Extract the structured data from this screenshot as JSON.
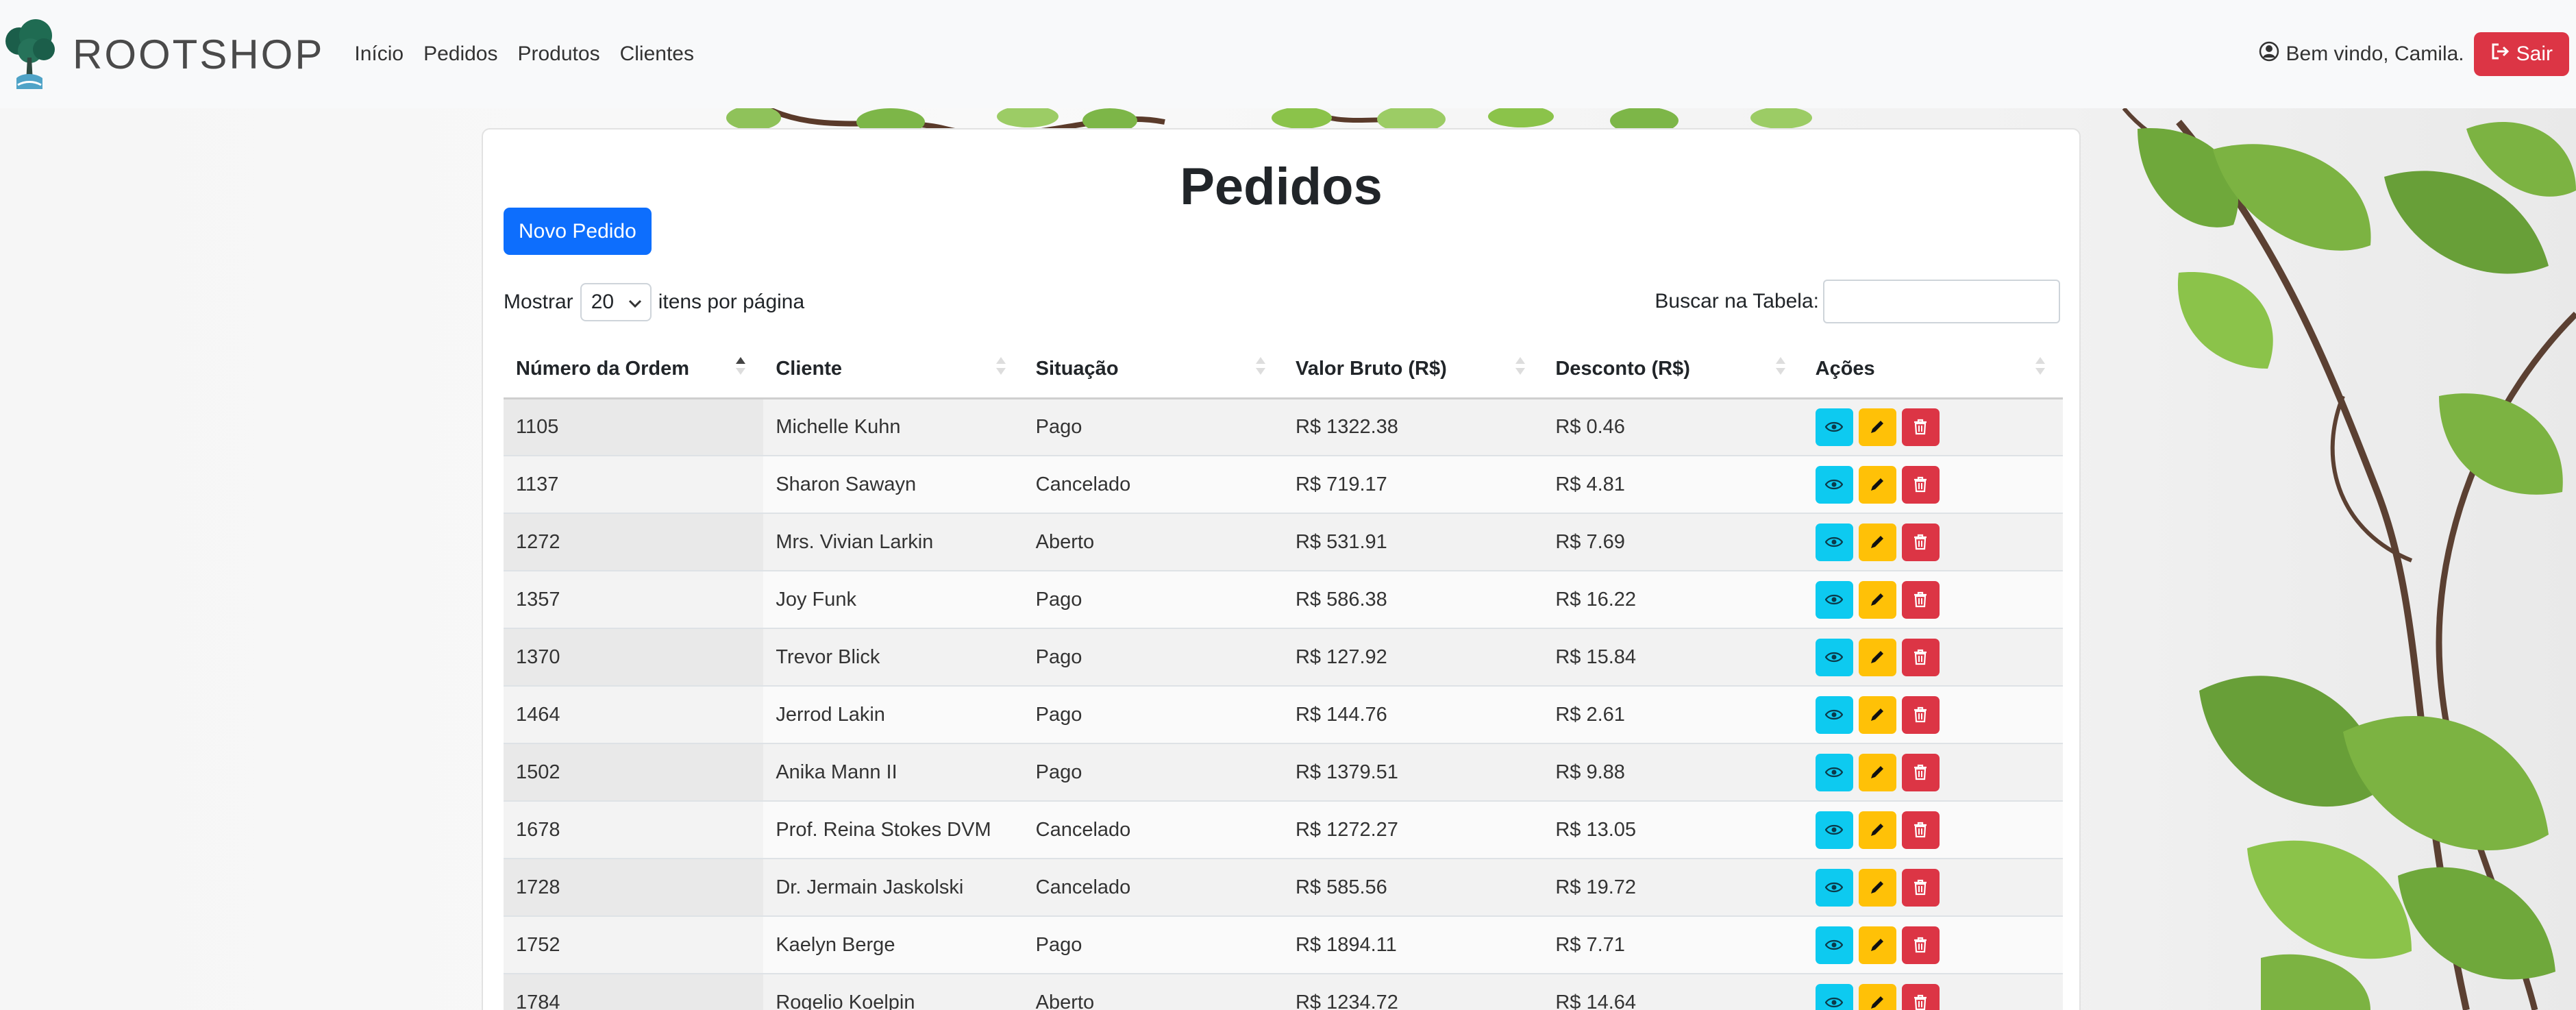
{
  "nav": {
    "brand": "ROOTSHOP",
    "links": [
      "Início",
      "Pedidos",
      "Produtos",
      "Clientes"
    ],
    "welcome": "Bem vindo, Camila.",
    "logout": "Sair"
  },
  "page": {
    "title": "Pedidos",
    "new_button": "Novo Pedido",
    "length_prefix": "Mostrar",
    "length_value": "20",
    "length_suffix": "itens por página",
    "search_label": "Buscar na Tabela:",
    "search_value": ""
  },
  "table": {
    "columns": [
      "Número da Ordem",
      "Cliente",
      "Situação",
      "Valor Bruto (R$)",
      "Desconto (R$)",
      "Ações"
    ],
    "sorted_column": "Número da Ordem",
    "rows": [
      {
        "id": "1105",
        "client": "Michelle Kuhn",
        "status": "Pago",
        "gross": "R$ 1322.38",
        "discount": "R$ 0.46"
      },
      {
        "id": "1137",
        "client": "Sharon Sawayn",
        "status": "Cancelado",
        "gross": "R$ 719.17",
        "discount": "R$ 4.81"
      },
      {
        "id": "1272",
        "client": "Mrs. Vivian Larkin",
        "status": "Aberto",
        "gross": "R$ 531.91",
        "discount": "R$ 7.69"
      },
      {
        "id": "1357",
        "client": "Joy Funk",
        "status": "Pago",
        "gross": "R$ 586.38",
        "discount": "R$ 16.22"
      },
      {
        "id": "1370",
        "client": "Trevor Blick",
        "status": "Pago",
        "gross": "R$ 127.92",
        "discount": "R$ 15.84"
      },
      {
        "id": "1464",
        "client": "Jerrod Lakin",
        "status": "Pago",
        "gross": "R$ 144.76",
        "discount": "R$ 2.61"
      },
      {
        "id": "1502",
        "client": "Anika Mann II",
        "status": "Pago",
        "gross": "R$ 1379.51",
        "discount": "R$ 9.88"
      },
      {
        "id": "1678",
        "client": "Prof. Reina Stokes DVM",
        "status": "Cancelado",
        "gross": "R$ 1272.27",
        "discount": "R$ 13.05"
      },
      {
        "id": "1728",
        "client": "Dr. Jermain Jaskolski",
        "status": "Cancelado",
        "gross": "R$ 585.56",
        "discount": "R$ 19.72"
      },
      {
        "id": "1752",
        "client": "Kaelyn Berge",
        "status": "Pago",
        "gross": "R$ 1894.11",
        "discount": "R$ 7.71"
      },
      {
        "id": "1784",
        "client": "Rogelio Koelpin",
        "status": "Aberto",
        "gross": "R$ 1234.72",
        "discount": "R$ 14.64"
      }
    ]
  },
  "colors": {
    "primary": "#0d6efd",
    "danger": "#dc3545",
    "info": "#0dcaf0",
    "warning": "#ffc107"
  },
  "icons": {
    "logo": "tree-logo-icon",
    "user": "user-circle-icon",
    "logout": "logout-icon",
    "view": "eye-icon",
    "edit": "pencil-icon",
    "delete": "trash-icon"
  }
}
